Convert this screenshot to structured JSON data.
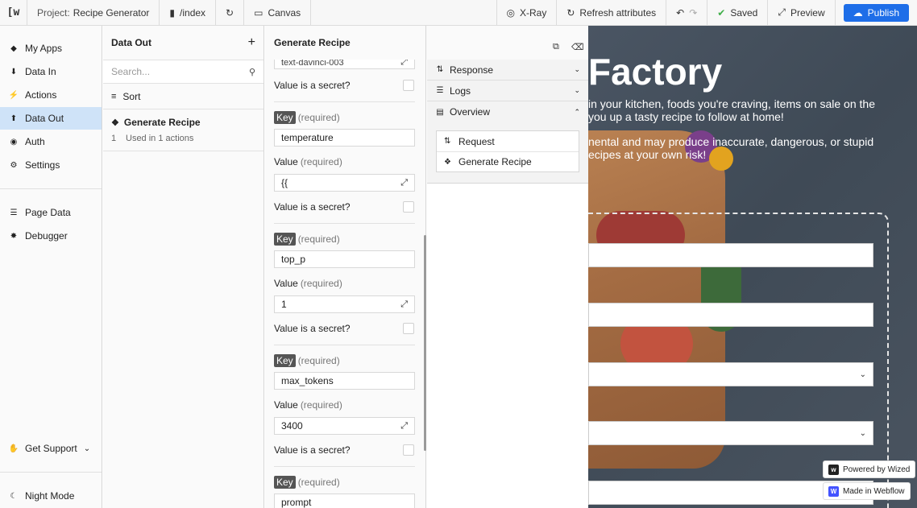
{
  "topbar": {
    "logo": "[w",
    "project_label": "Project:",
    "project_name": "Recipe Generator",
    "page": "/index",
    "canvas": "Canvas",
    "xray": "X-Ray",
    "refresh": "Refresh attributes",
    "saved": "Saved",
    "preview": "Preview",
    "publish": "Publish"
  },
  "sidebar": {
    "items": [
      {
        "label": "My Apps"
      },
      {
        "label": "Data In"
      },
      {
        "label": "Actions"
      },
      {
        "label": "Data Out"
      },
      {
        "label": "Auth"
      },
      {
        "label": "Settings"
      },
      {
        "label": "Page Data"
      },
      {
        "label": "Debugger"
      }
    ],
    "support": "Get Support",
    "night_mode": "Night Mode"
  },
  "data_out": {
    "title": "Data Out",
    "search_placeholder": "Search...",
    "sort": "Sort",
    "item": {
      "name": "Generate Recipe",
      "count": "1",
      "usage": "Used in 1 actions"
    }
  },
  "config": {
    "title": "Generate Recipe",
    "top_value": "text-davinci-003",
    "secret_label": "Value is a secret?",
    "key_label": "Key",
    "value_label": "Value",
    "required": "(required)",
    "params": [
      {
        "key": "temperature",
        "value": "{{"
      },
      {
        "key": "top_p",
        "value": "1"
      },
      {
        "key": "max_tokens",
        "value": "3400"
      },
      {
        "key": "prompt"
      }
    ]
  },
  "right_panel": {
    "response": "Response",
    "logs": "Logs",
    "overview": "Overview",
    "overview_items": [
      {
        "label": "Request"
      },
      {
        "label": "Generate Recipe"
      }
    ]
  },
  "canvas": {
    "title": "Factory",
    "p1_line1": "in your kitchen, foods you're craving, items on sale on the",
    "p1_line2": "you up a tasty recipe to follow at home!",
    "p2_line1": "nental and may produce inaccurate, dangerous, or stupid",
    "p2_line2": "ecipes at your own risk!",
    "badge_wized": "Powered by Wized",
    "badge_webflow": "Made in Webflow"
  }
}
